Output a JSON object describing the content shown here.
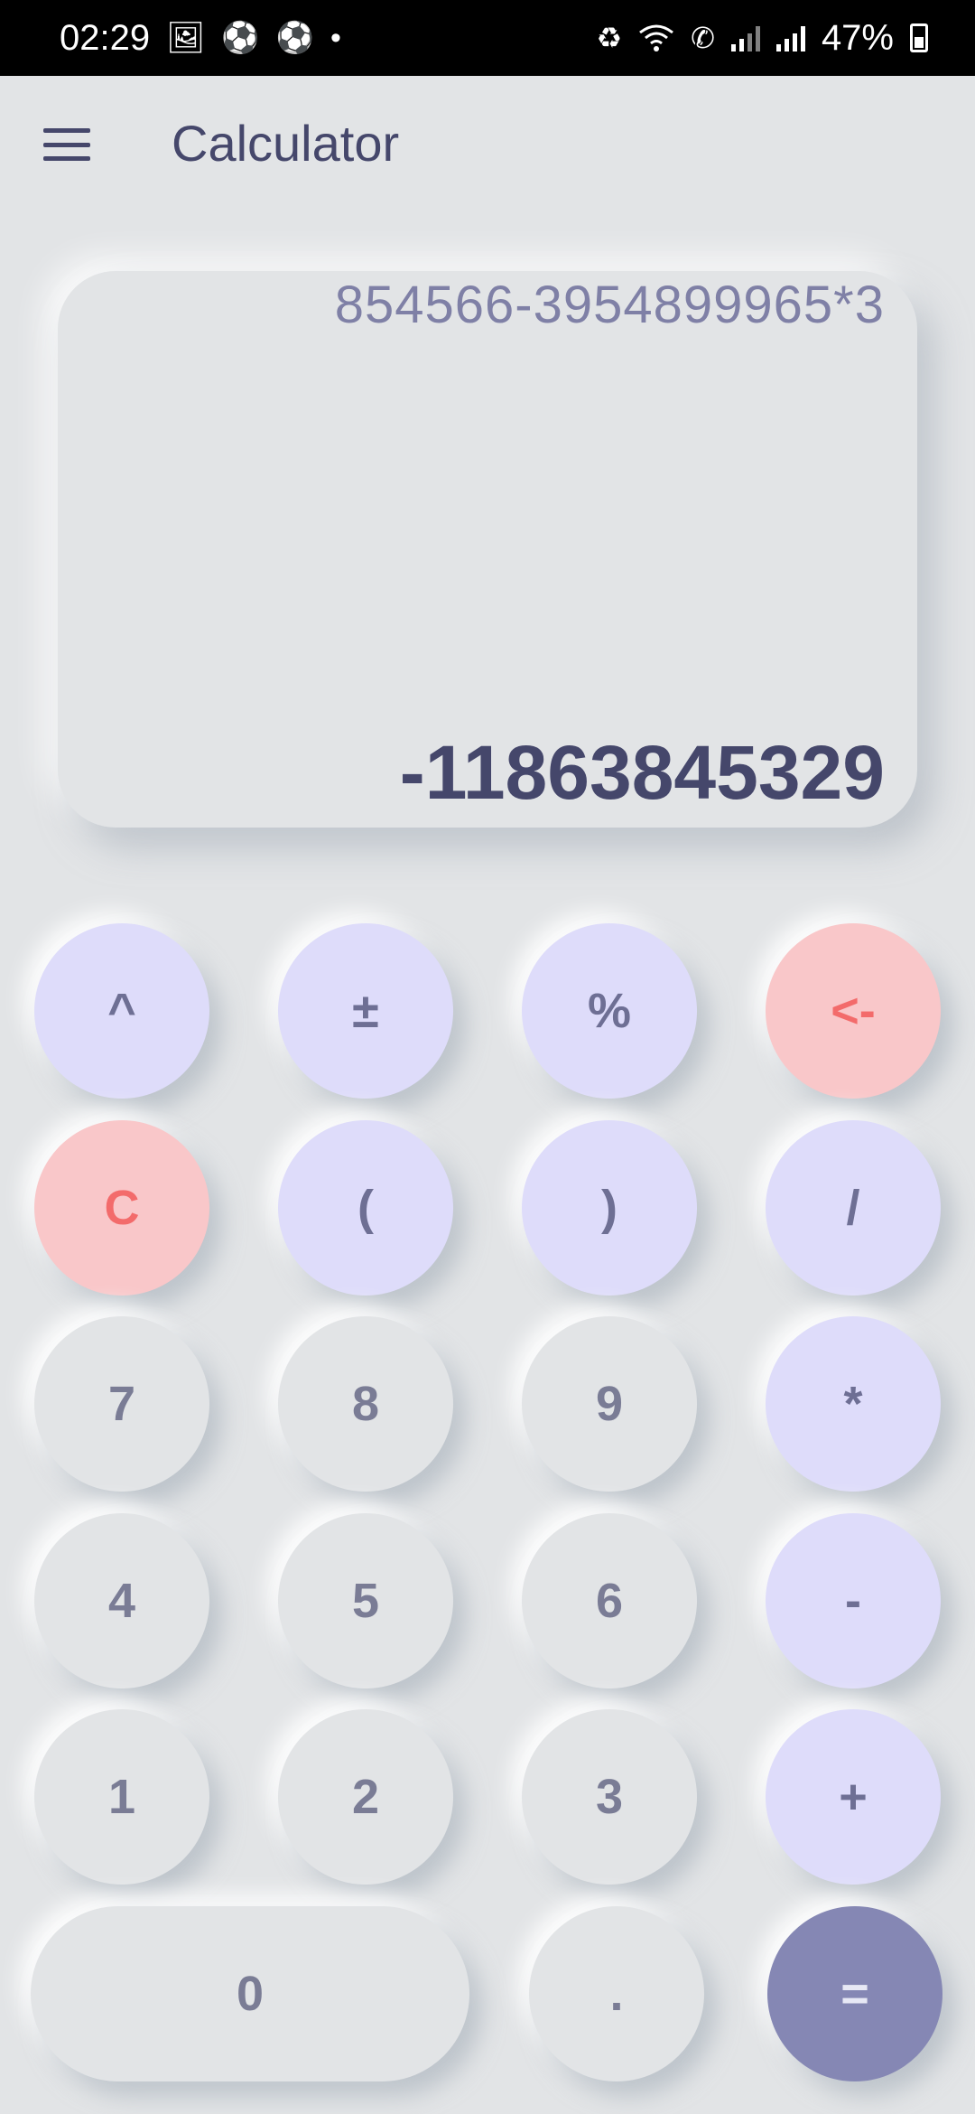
{
  "status_bar": {
    "time": "02:29",
    "battery_percent": "47%",
    "left_icons": [
      "image-icon",
      "soccer-ball-icon",
      "soccer-ball-icon",
      "dot-icon"
    ],
    "right_icons": [
      "battery-saver-icon",
      "wifi-icon",
      "wifi-calling-icon",
      "signal-icon",
      "signal-icon",
      "battery-icon"
    ]
  },
  "app_bar": {
    "title": "Calculator",
    "menu_icon": "hamburger-menu-icon"
  },
  "display": {
    "expression": "854566-3954899965*3",
    "result": "-11863845329"
  },
  "keys": {
    "power": "^",
    "plus_minus": "±",
    "percent": "%",
    "backspace": "<-",
    "clear": "C",
    "open_paren": "(",
    "close_paren": ")",
    "divide": "/",
    "seven": "7",
    "eight": "8",
    "nine": "9",
    "multiply": "*",
    "four": "4",
    "five": "5",
    "six": "6",
    "minus": "-",
    "one": "1",
    "two": "2",
    "three": "3",
    "plus": "+",
    "zero": "0",
    "decimal": ".",
    "equals": "="
  },
  "colors": {
    "background": "#e2e4e6",
    "operator_key": "#dedcfa",
    "danger_key": "#f9c7c9",
    "danger_text": "#f36b6b",
    "equals_key": "#8587b4",
    "primary_text": "#45476b"
  }
}
